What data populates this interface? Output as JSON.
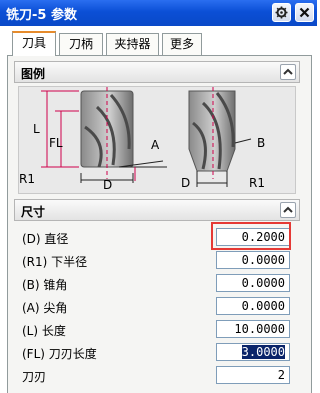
{
  "window": {
    "title": "铣刀-5 参数"
  },
  "tabs": [
    {
      "label": "刀具",
      "active": true
    },
    {
      "label": "刀柄",
      "active": false
    },
    {
      "label": "夹持器",
      "active": false
    },
    {
      "label": "更多",
      "active": false
    }
  ],
  "illustration": {
    "title": "图例",
    "labels": {
      "L": "L",
      "FL": "FL",
      "R1": "R1",
      "D": "D",
      "A": "A",
      "B": "B"
    }
  },
  "size": {
    "title": "尺寸",
    "rows": [
      {
        "label": "(D) 直径",
        "value": "0.2000"
      },
      {
        "label": "(R1) 下半径",
        "value": "0.0000"
      },
      {
        "label": "(B) 锥角",
        "value": "0.0000"
      },
      {
        "label": "(A) 尖角",
        "value": "0.0000"
      },
      {
        "label": "(L) 长度",
        "value": "10.0000"
      },
      {
        "label": "(FL) 刀刃长度",
        "value": "3.0000"
      },
      {
        "label": "刀刃",
        "value": "2"
      }
    ]
  },
  "colors": {
    "titlebar": "#0b4fd6",
    "highlight": "#e53935",
    "tab_accent": "#e68b2c"
  }
}
